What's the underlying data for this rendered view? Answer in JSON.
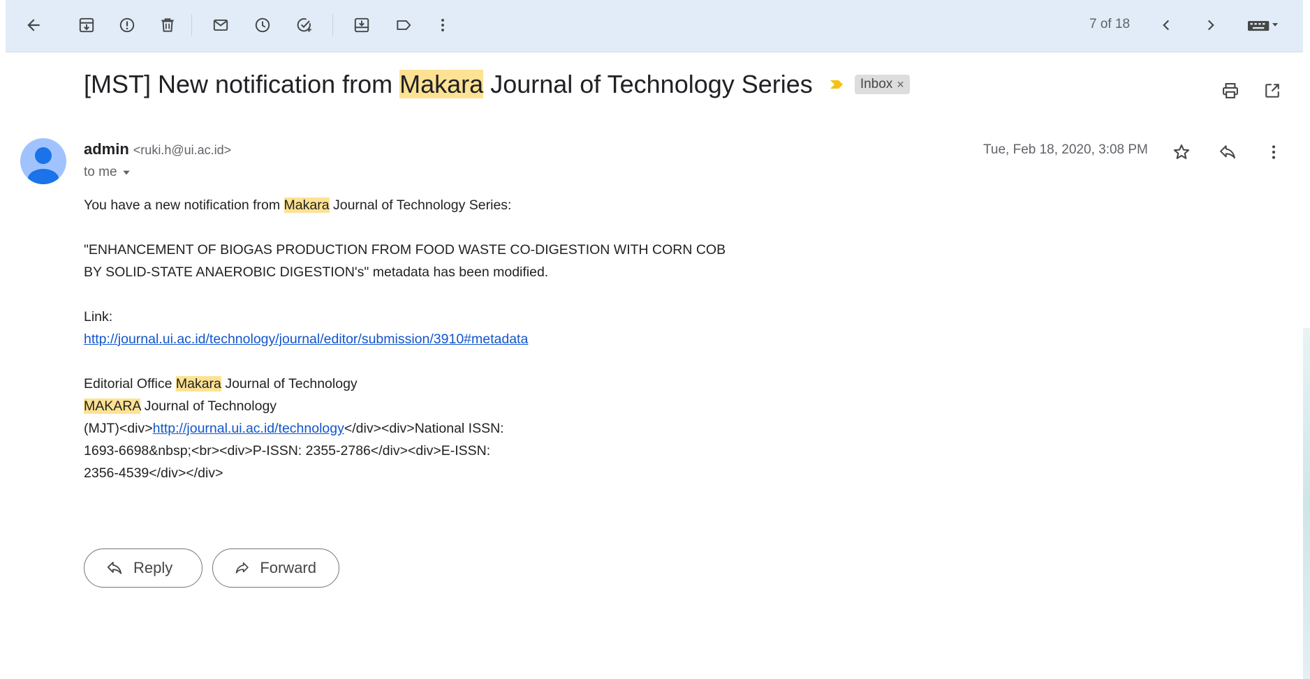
{
  "toolbar": {
    "icons": [
      "back-arrow-icon",
      "archive-icon",
      "report-spam-icon",
      "delete-icon",
      "mark-unread-icon",
      "snooze-icon",
      "add-to-tasks-icon",
      "move-to-icon",
      "label-icon",
      "more-vert-icon"
    ],
    "pager_text": "7 of 18",
    "input_tools_icon": "keyboard-icon"
  },
  "email": {
    "subject_before": "[MST] New notification from ",
    "subject_highlight": "Makara",
    "subject_after": " Journal of Technology Series",
    "label_chip": "Inbox",
    "label_chip_close": "×",
    "sender_name": "admin",
    "sender_email": "<ruki.h@ui.ac.id>",
    "recipient": "to me",
    "date": "Tue, Feb 18, 2020, 3:08 PM"
  },
  "body": {
    "intro_before": "You have a new notification from ",
    "intro_highlight": "Makara",
    "intro_after": " Journal of Technology Series:",
    "title_line1": "\"ENHANCEMENT OF BIOGAS PRODUCTION FROM FOOD WASTE CO-DIGESTION WITH CORN COB",
    "title_line2": "BY SOLID-STATE ANAEROBIC DIGESTION's\" metadata has been modified.",
    "link_label": "Link:",
    "link_url": "http://journal.ui.ac.id/technology/journal/editor/submission/3910#metadata",
    "sig1_before": "Editorial Office ",
    "sig1_highlight": "Makara",
    "sig1_after": " Journal of Technology",
    "sig2_highlight": "MAKARA",
    "sig2_after": " Journal of Technology",
    "sig3_before": "(MJT)<div>",
    "sig3_link": "http://journal.ui.ac.id/technology",
    "sig3_after": "</div><div>National ISSN:",
    "sig4": "1693-6698&nbsp;<br><div>P-ISSN: 2355-2786</div><div>E-ISSN:",
    "sig5": "2356-4539</div></div>"
  },
  "actions": {
    "reply": "Reply",
    "forward": "Forward"
  },
  "colors": {
    "toolbar_bg": "#e1ecf8",
    "highlight": "#fde293",
    "link": "#1155cc",
    "avatar": "#a0c3ff",
    "importance": "#f2c314"
  }
}
